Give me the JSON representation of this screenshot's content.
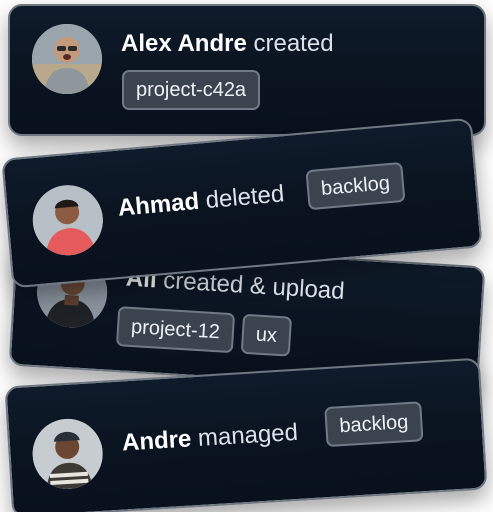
{
  "feed": [
    {
      "user": "Alex Andre",
      "action": "created",
      "tags": [
        "project-c42a"
      ],
      "avatar": "person-with-glasses-avatar"
    },
    {
      "user": "Ahmad",
      "action": "deleted",
      "tags": [
        "backlog"
      ],
      "avatar": "person-with-red-shirt-avatar"
    },
    {
      "user": "Ali",
      "action": "created & upload",
      "tags": [
        "project-12",
        "ux"
      ],
      "avatar": "person-with-dark-jacket-avatar"
    },
    {
      "user": "Andre",
      "action": "managed",
      "tags": [
        "backlog"
      ],
      "avatar": "person-with-cap-avatar"
    }
  ]
}
